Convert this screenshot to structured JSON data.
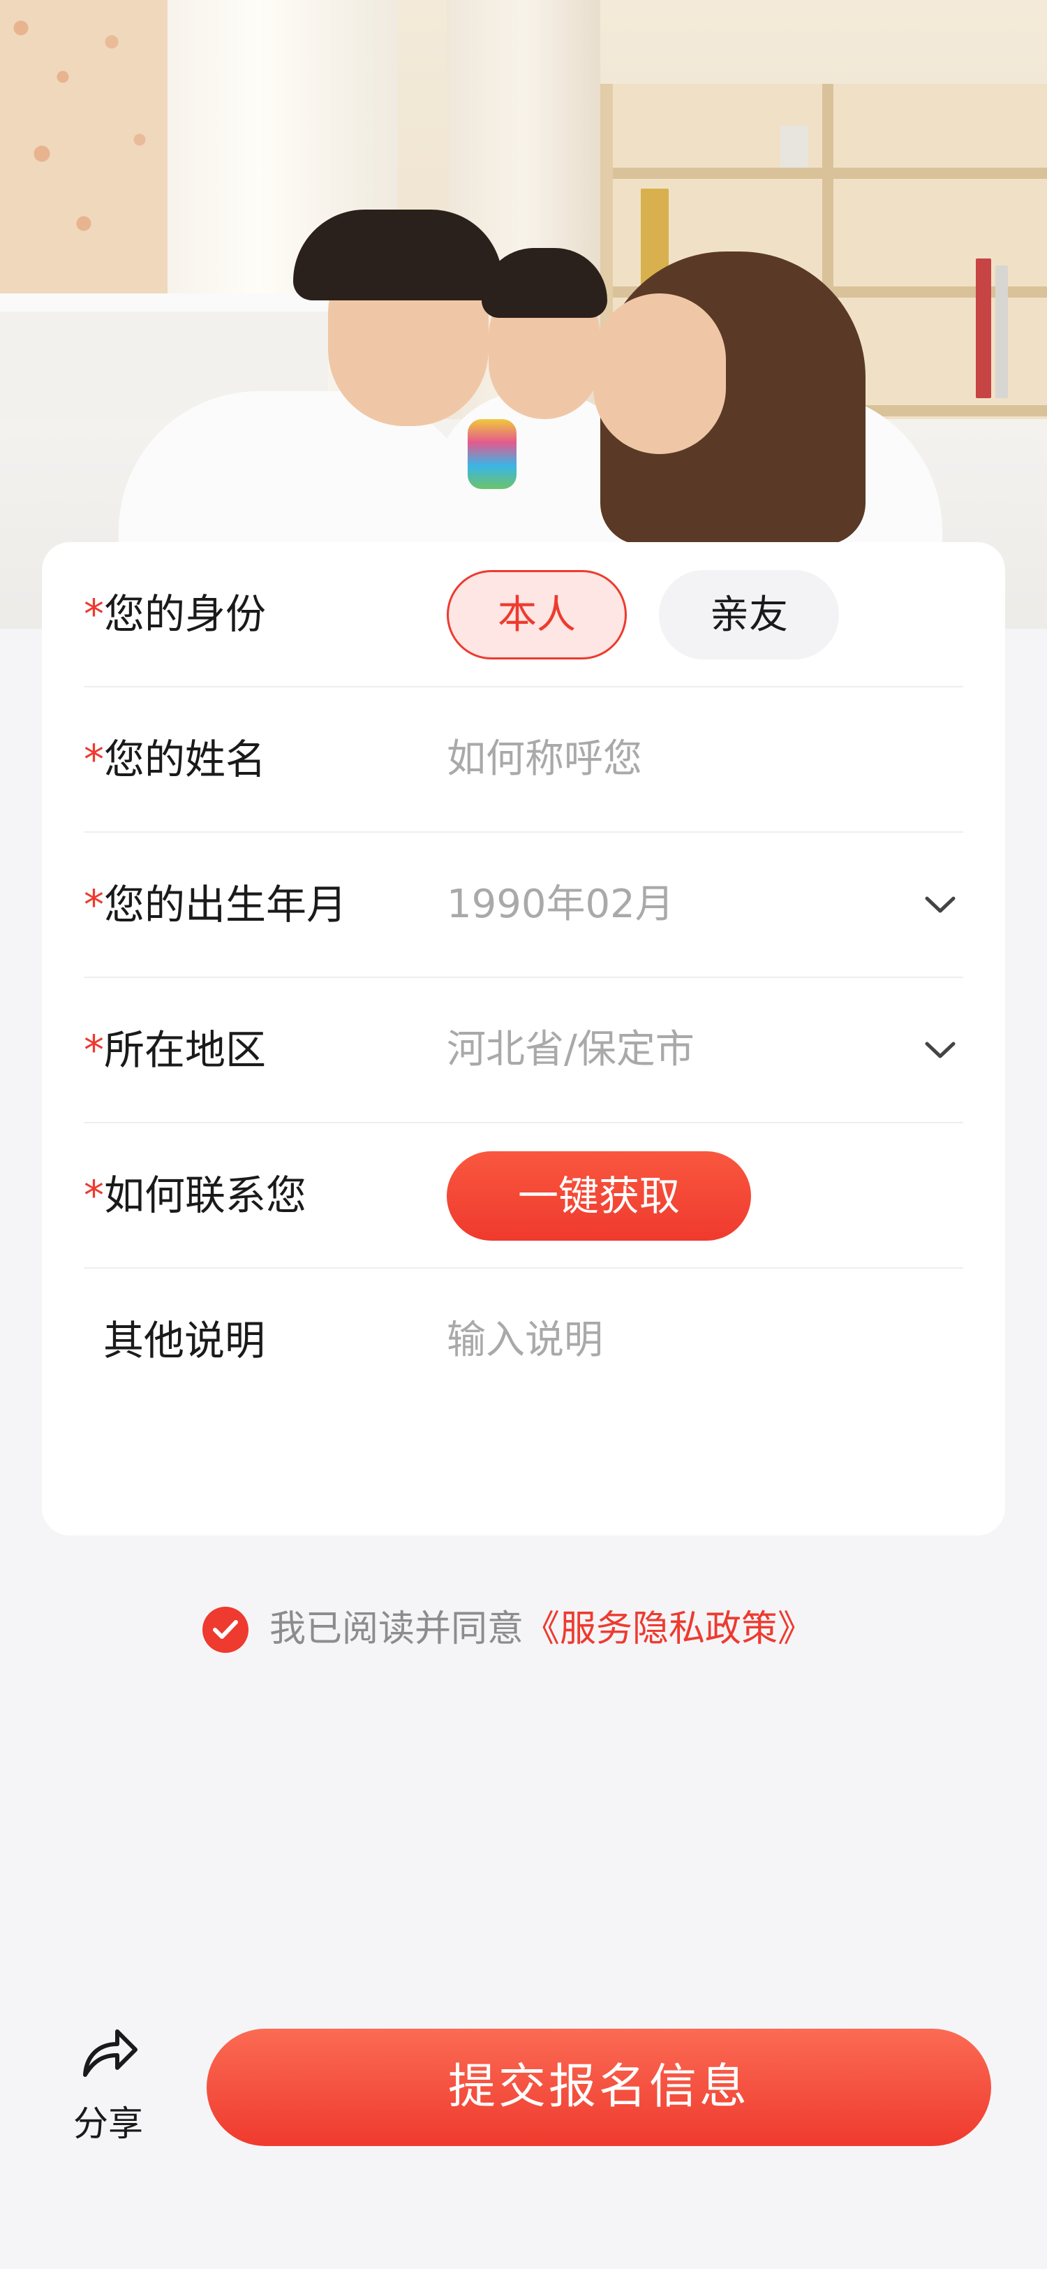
{
  "form": {
    "identity": {
      "required_mark": "*",
      "label": "您的身份",
      "options": [
        "本人",
        "亲友"
      ],
      "selected": "本人"
    },
    "name": {
      "required_mark": "*",
      "label": "您的姓名",
      "placeholder": "如何称呼您"
    },
    "birth": {
      "required_mark": "*",
      "label": "您的出生年月",
      "placeholder": "1990年02月"
    },
    "region": {
      "required_mark": "*",
      "label": "所在地区",
      "placeholder": "河北省/保定市"
    },
    "contact": {
      "required_mark": "*",
      "label": "如何联系您",
      "button_label": "一键获取"
    },
    "notes": {
      "label": "其他说明",
      "placeholder": "输入说明"
    }
  },
  "agreement": {
    "checked": true,
    "text": "我已阅读并同意",
    "link": "《服务隐私政策》"
  },
  "bottom_bar": {
    "share_label": "分享",
    "submit_label": "提交报名信息"
  },
  "colors": {
    "accent": "#ee3a2f",
    "accent_light": "#fde6e3",
    "page_background": "#f5f5f7",
    "placeholder": "#a9a9a9"
  }
}
